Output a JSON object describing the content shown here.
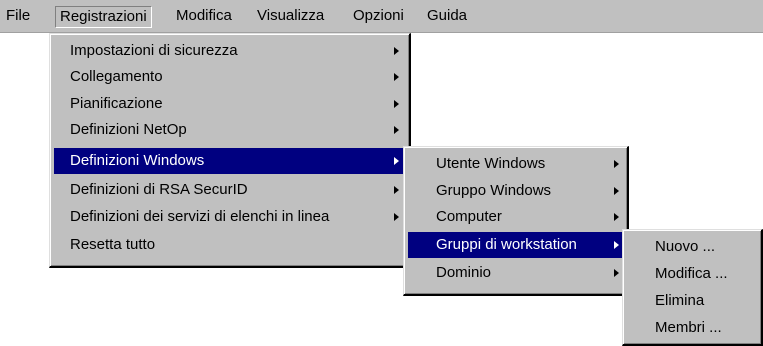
{
  "menubar": {
    "file": "File",
    "registrazioni": "Registrazioni",
    "modifica": "Modifica",
    "visualizza": "Visualizza",
    "opzioni": "Opzioni",
    "guida": "Guida"
  },
  "main_menu": {
    "items": [
      {
        "label": "Impostazioni di sicurezza"
      },
      {
        "label": "Collegamento"
      },
      {
        "label": "Pianificazione"
      },
      {
        "label": "Definizioni NetOp"
      },
      {
        "label": "Definizioni Windows"
      },
      {
        "label": "Definizioni di RSA SecurID"
      },
      {
        "label": "Definizioni dei servizi di elenchi in linea"
      },
      {
        "label": "Resetta tutto"
      }
    ]
  },
  "windows_menu": {
    "items": [
      {
        "label": "Utente Windows"
      },
      {
        "label": "Gruppo Windows"
      },
      {
        "label": "Computer"
      },
      {
        "label": "Gruppi di workstation"
      },
      {
        "label": "Dominio"
      }
    ]
  },
  "groups_menu": {
    "items": [
      {
        "label": "Nuovo ..."
      },
      {
        "label": "Modifica ..."
      },
      {
        "label": "Elimina"
      },
      {
        "label": "Membri ..."
      }
    ]
  },
  "colors": {
    "menu_background": "#c0c0c0",
    "selection_background": "#000080",
    "selection_text": "#ffffff"
  },
  "icons": {
    "submenu_indicator": "submenu-arrow-icon"
  }
}
